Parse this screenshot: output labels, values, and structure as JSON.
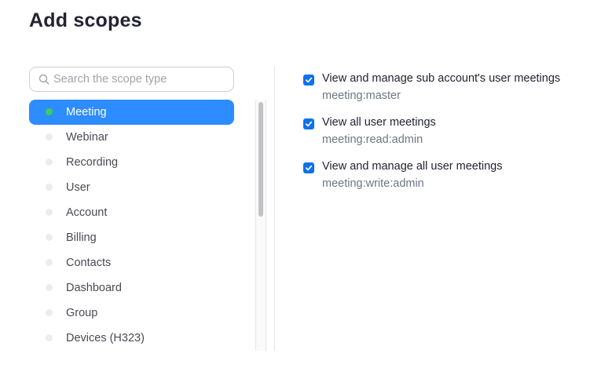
{
  "page": {
    "title": "Add scopes"
  },
  "search": {
    "placeholder": "Search the scope type",
    "icon": "search-icon"
  },
  "categories": [
    {
      "label": "Meeting",
      "active": true
    },
    {
      "label": "Webinar",
      "active": false
    },
    {
      "label": "Recording",
      "active": false
    },
    {
      "label": "User",
      "active": false
    },
    {
      "label": "Account",
      "active": false
    },
    {
      "label": "Billing",
      "active": false
    },
    {
      "label": "Contacts",
      "active": false
    },
    {
      "label": "Dashboard",
      "active": false
    },
    {
      "label": "Group",
      "active": false
    },
    {
      "label": "Devices (H323)",
      "active": false
    }
  ],
  "scopes": [
    {
      "name": "View and manage sub account's user meetings",
      "code": "meeting:master",
      "checked": true
    },
    {
      "name": "View all user meetings",
      "code": "meeting:read:admin",
      "checked": true
    },
    {
      "name": "View and manage all user meetings",
      "code": "meeting:write:admin",
      "checked": true
    }
  ],
  "colors": {
    "accent": "#2d8cff",
    "active_dot": "#3ccf57",
    "checkbox": "#0e72ed"
  }
}
